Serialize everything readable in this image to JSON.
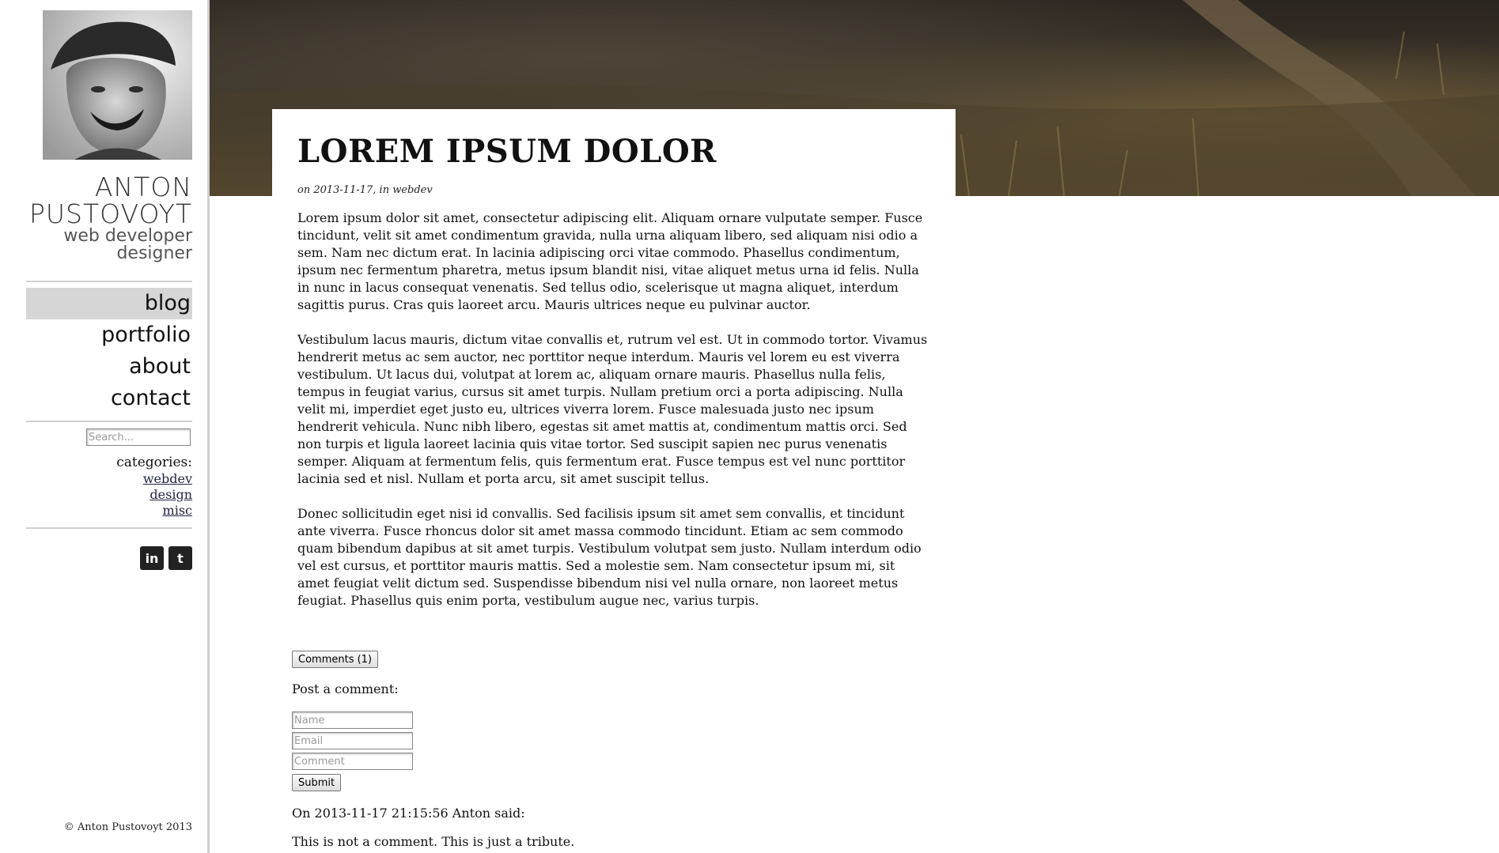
{
  "sidebar": {
    "name_line1": "ANTON",
    "name_line2": "PUSTOVOYT",
    "role_line1": "web developer",
    "role_line2": "designer",
    "nav": [
      {
        "label": "blog",
        "active": true
      },
      {
        "label": "portfolio",
        "active": false
      },
      {
        "label": "about",
        "active": false
      },
      {
        "label": "contact",
        "active": false
      }
    ],
    "search_placeholder": "Search...",
    "categories_label": "categories:",
    "categories": [
      "webdev",
      "design",
      "misc"
    ],
    "social": [
      {
        "icon": "linkedin-icon",
        "glyph": "in"
      },
      {
        "icon": "twitter-icon",
        "glyph": "t"
      }
    ],
    "copyright": "© Anton Pustovoyt 2013"
  },
  "post": {
    "title": "LOREM IPSUM DOLOR",
    "meta": "on 2013-11-17, in webdev",
    "paragraphs": [
      "Lorem ipsum dolor sit amet, consectetur adipiscing elit. Aliquam ornare vulputate semper. Fusce tincidunt, velit sit amet condimentum gravida, nulla urna aliquam libero, sed aliquam nisi odio a sem. Nam nec dictum erat. In lacinia adipiscing orci vitae commodo. Phasellus condimentum, ipsum nec fermentum pharetra, metus ipsum blandit nisi, vitae aliquet metus urna id felis. Nulla in nunc in lacus consequat venenatis. Sed tellus odio, scelerisque ut magna aliquet, interdum sagittis purus. Cras quis laoreet arcu. Mauris ultrices neque eu pulvinar auctor.",
      "Vestibulum lacus mauris, dictum vitae convallis et, rutrum vel est. Ut in commodo tortor. Vivamus hendrerit metus ac sem auctor, nec porttitor neque interdum. Mauris vel lorem eu est viverra vestibulum. Ut lacus dui, volutpat at lorem ac, aliquam ornare mauris. Phasellus nulla felis, tempus in feugiat varius, cursus sit amet turpis. Nullam pretium orci a porta adipiscing. Nulla velit mi, imperdiet eget justo eu, ultrices viverra lorem. Fusce malesuada justo nec ipsum hendrerit vehicula. Nunc nibh libero, egestas sit amet mattis at, condimentum mattis orci. Sed non turpis et ligula laoreet lacinia quis vitae tortor. Sed suscipit sapien nec purus venenatis semper. Aliquam at fermentum felis, quis fermentum erat. Fusce tempus est vel nunc porttitor lacinia sed et nisl. Nullam et porta arcu, sit amet suscipit tellus.",
      "Donec sollicitudin eget nisi id convallis. Sed facilisis ipsum sit amet sem convallis, et tincidunt ante viverra. Fusce rhoncus dolor sit amet massa commodo tincidunt. Etiam ac sem commodo quam bibendum dapibus at sit amet turpis. Vestibulum volutpat sem justo. Nullam interdum odio vel est cursus, et porttitor mauris mattis. Sed a molestie sem. Nam consectetur ipsum mi, sit amet feugiat velit dictum sed. Suspendisse bibendum nisi vel nulla ornare, non laoreet metus feugiat. Phasellus quis enim porta, vestibulum augue nec, varius turpis."
    ]
  },
  "comments": {
    "toggle_label": "Comments (1)",
    "post_label": "Post a comment:",
    "name_placeholder": "Name",
    "email_placeholder": "Email",
    "comment_placeholder": "Comment",
    "submit_label": "Submit",
    "items": [
      {
        "header": "On 2013-11-17 21:15:56 Anton said:",
        "text": "This is not a comment. This is just a tribute."
      }
    ]
  },
  "colors": {
    "active_nav_bg": "#d6d6d6",
    "divider": "#cfcfcf",
    "link": "#224"
  }
}
